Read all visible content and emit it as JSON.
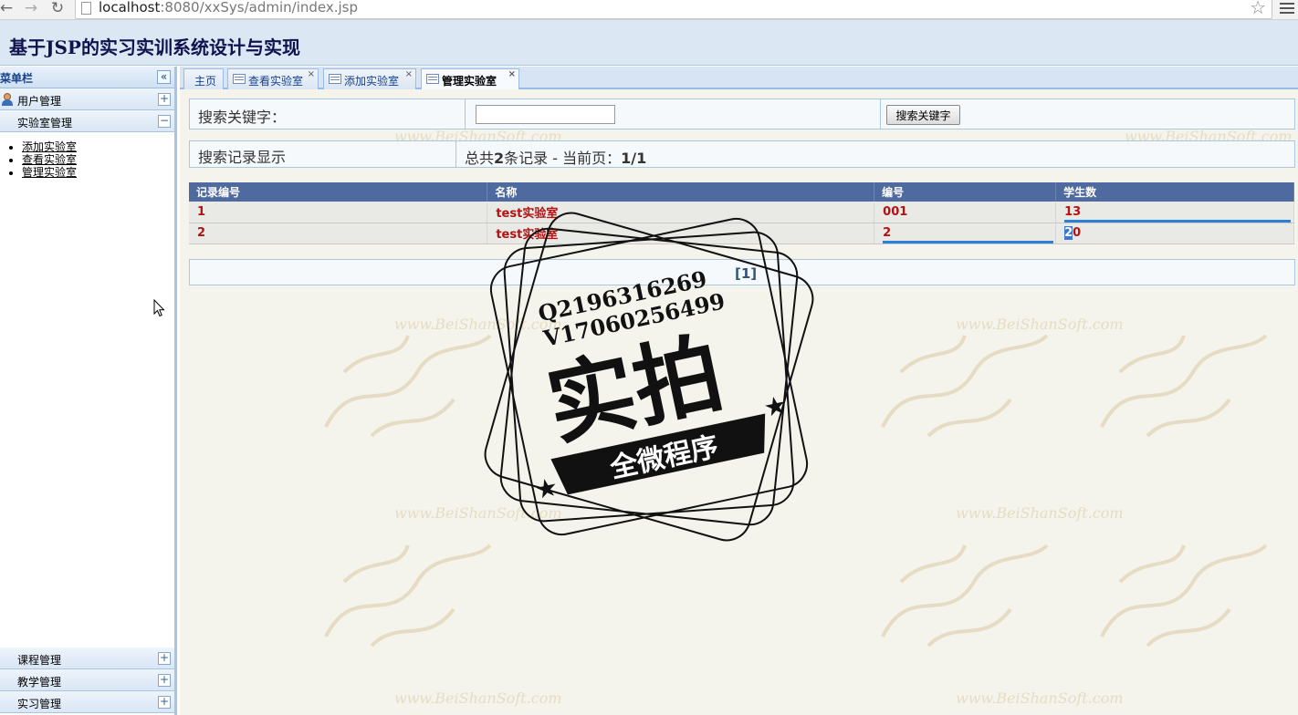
{
  "browser": {
    "url_host": "localhost",
    "url_rest": ":8080/xxSys/admin/index.jsp",
    "back_icon": "back-arrow-icon",
    "forward_icon": "forward-arrow-icon",
    "reload_icon": "reload-icon",
    "bookmark_icon": "star-icon",
    "menu_icon": "hamburger-menu-icon"
  },
  "app": {
    "title": "基于JSP的实习实训系统设计与实现"
  },
  "sidebar": {
    "title": "菜单栏",
    "collapse_glyph": "«",
    "sections": [
      {
        "label": "用户管理",
        "toggle": "+"
      },
      {
        "label": "实验室管理",
        "toggle": "−"
      }
    ],
    "links": [
      "添加实验室",
      "查看实验室",
      "管理实验室"
    ],
    "bottom_sections": [
      {
        "label": "课程管理",
        "toggle": "+"
      },
      {
        "label": "教学管理",
        "toggle": "+"
      },
      {
        "label": "实习管理",
        "toggle": "+"
      }
    ]
  },
  "tabs": [
    {
      "label": "主页"
    },
    {
      "label": "查看实验室",
      "close": "×"
    },
    {
      "label": "添加实验室",
      "close": "×"
    },
    {
      "label": "管理实验室",
      "close": "×",
      "active": true
    }
  ],
  "search": {
    "label": "搜索关键字：",
    "value": "",
    "placeholder": "",
    "button": "搜索关键字"
  },
  "records": {
    "label": "搜索记录显示",
    "summary_prefix": "总共",
    "total": "2",
    "summary_mid": "条记录 - 当前页：",
    "page": "1/1"
  },
  "table": {
    "columns": [
      "记录编号",
      "名称",
      "编号",
      "学生数"
    ],
    "rows": [
      {
        "id": "1",
        "name": "test实验室",
        "code": "001",
        "students": "13"
      },
      {
        "id": "2",
        "name": "test实验室",
        "code": "2",
        "students_sel": "2",
        "students_rest": "0"
      }
    ]
  },
  "pager": {
    "text": "[1]"
  },
  "watermark": {
    "site": "www.BeiShanSoft.com",
    "stamp_line1": "Q2196316269",
    "stamp_line2": "V17060256499",
    "stamp_big": "实拍",
    "stamp_banner": "全微程序"
  },
  "colors": {
    "header_bg": "#dbe7f3",
    "title_color": "#10134e",
    "table_header_bg": "#4f6a9e",
    "cell_text": "#b21212",
    "content_bg": "#f4f4ec"
  }
}
